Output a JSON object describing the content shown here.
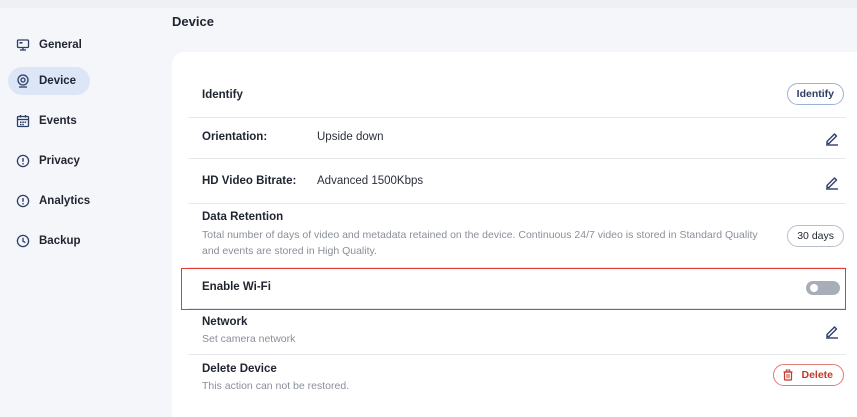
{
  "page": {
    "title": "Device"
  },
  "sidebar": {
    "items": [
      {
        "label": "General",
        "icon": "monitor-icon",
        "active": false
      },
      {
        "label": "Device",
        "icon": "camera-icon",
        "active": true
      },
      {
        "label": "Events",
        "icon": "calendar-icon",
        "active": false
      },
      {
        "label": "Privacy",
        "icon": "shield-icon",
        "active": false
      },
      {
        "label": "Analytics",
        "icon": "shield-icon",
        "active": false
      },
      {
        "label": "Backup",
        "icon": "clock-icon",
        "active": false
      }
    ]
  },
  "settings": {
    "identify": {
      "label": "Identify",
      "button": "Identify"
    },
    "orientation": {
      "label": "Orientation:",
      "value": "Upside down"
    },
    "bitrate": {
      "label": "HD Video Bitrate:",
      "value": "Advanced 1500Kbps"
    },
    "retention": {
      "label": "Data Retention",
      "description": "Total number of days of video and metadata retained on the device. Continuous 24/7 video is stored in Standard Quality and events are stored in High Quality.",
      "button": "30 days"
    },
    "wifi": {
      "label": "Enable Wi-Fi",
      "enabled": false
    },
    "network": {
      "label": "Network",
      "description": "Set camera network"
    },
    "delete": {
      "label": "Delete Device",
      "description": "This action can not be restored.",
      "button": "Delete"
    }
  },
  "colors": {
    "accent": "#dce6f7",
    "danger": "#c0392b",
    "highlight": "#e53935",
    "toggle_off": "#a8aeb9"
  }
}
